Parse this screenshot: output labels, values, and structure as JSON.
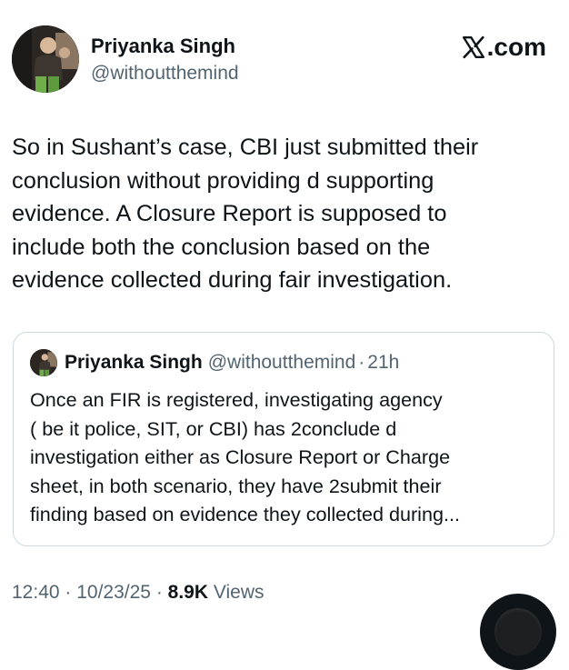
{
  "author": {
    "name": "Priyanka Singh",
    "handle": "@withoutthemind"
  },
  "brand": {
    "label": ".com",
    "icon": "x-logo-icon"
  },
  "tweet": {
    "lines": [
      "So in Sushant’s case, CBI just submitted  their",
      "conclusion without providing d supporting",
      "evidence. A Closure Report is supposed to",
      "include both the conclusion based on the",
      "evidence collected during fair investigation."
    ]
  },
  "quote": {
    "name": "Priyanka Singh",
    "handle": "@withoutthemind",
    "separator": "·",
    "time": "21h",
    "lines": [
      "Once an FIR is registered, investigating agency",
      "( be it police, SIT, or CBI) has 2conclude d",
      "investigation either as Closure Report or Charge",
      "sheet, in both scenario, they have 2submit their",
      "finding based on evidence they collected during..."
    ]
  },
  "meta": {
    "time": "12:40",
    "sep1": " · ",
    "date": "10/23/25",
    "sep2": " · ",
    "views_count": "8.9K",
    "views_label": " Views"
  }
}
